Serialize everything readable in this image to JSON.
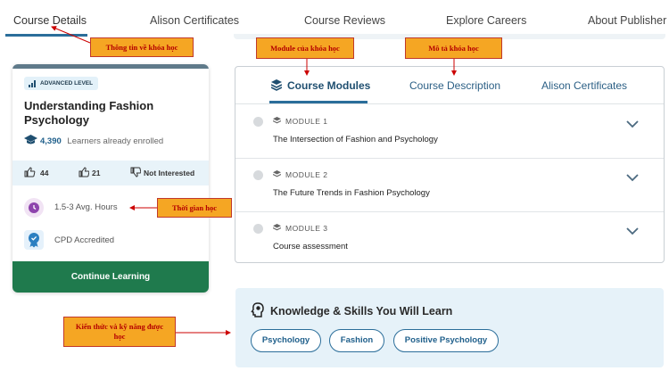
{
  "topnav": {
    "tabs": [
      "Course Details",
      "Alison Certificates",
      "Course Reviews",
      "Explore Careers",
      "About Publisher"
    ]
  },
  "course_card": {
    "level_badge": "ADVANCED LEVEL",
    "title": "Understanding Fashion Psychology",
    "learners_count": "4,390",
    "learners_text": "Learners already enrolled",
    "likes": "44",
    "thumbs": "21",
    "not_interested": "Not Interested",
    "duration": "1.5-3 Avg. Hours",
    "accreditation": "CPD Accredited",
    "cta": "Continue Learning"
  },
  "module_tabs": [
    "Course Modules",
    "Course Description",
    "Alison Certificates"
  ],
  "modules": [
    {
      "label": "MODULE 1",
      "name": "The Intersection of Fashion and Psychology"
    },
    {
      "label": "MODULE 2",
      "name": "The Future Trends in Fashion Psychology"
    },
    {
      "label": "MODULE 3",
      "name": "Course assessment"
    }
  ],
  "skills": {
    "heading": "Knowledge & Skills You Will Learn",
    "chips": [
      "Psychology",
      "Fashion",
      "Positive Psychology"
    ]
  },
  "annotations": {
    "course_info": "Thông tin về khóa học",
    "course_module": "Module của khóa học",
    "course_desc": "Mô tả khóa học",
    "study_time": "Thời gian học",
    "skills_learned": "Kiến thức và kỹ năng được học"
  },
  "colors": {
    "accent": "#2b6e9a",
    "cta_green": "#1f7a4d",
    "annotation_fill": "#f5a623",
    "annotation_text": "#b50000"
  }
}
